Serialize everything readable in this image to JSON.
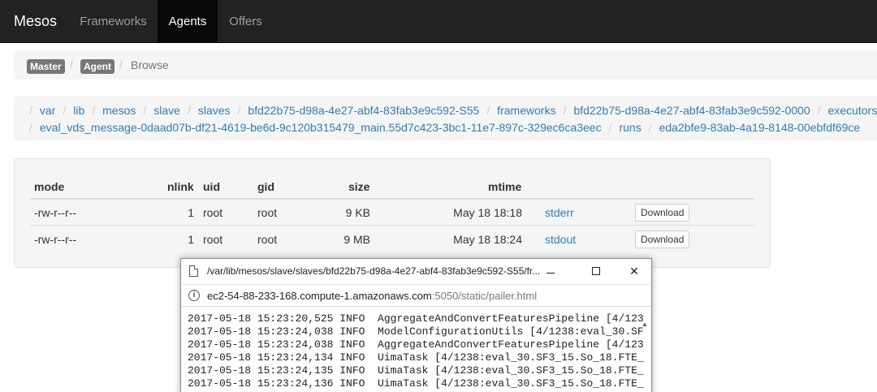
{
  "navbar": {
    "brand": "Mesos",
    "items": [
      "Frameworks",
      "Agents",
      "Offers"
    ],
    "active": "Agents"
  },
  "breadcrumb_top": {
    "items": [
      "Master",
      "Agent",
      "Browse"
    ]
  },
  "path": {
    "line1": [
      "var",
      "lib",
      "mesos",
      "slave",
      "slaves",
      "bfd22b75-d98a-4e27-abf4-83fab3e9c592-S55",
      "frameworks",
      "bfd22b75-d98a-4e27-abf4-83fab3e9c592-0000",
      "executors"
    ],
    "line2": [
      "eval_vds_message-0daad07b-df21-4619-be6d-9c120b315479_main.55d7c423-3bc1-11e7-897c-329ec6ca3eec",
      "runs",
      "eda2bfe9-83ab-4a19-8148-00ebfdf69ce"
    ]
  },
  "files": {
    "columns": [
      "mode",
      "nlink",
      "uid",
      "gid",
      "size",
      "mtime"
    ],
    "rows": [
      {
        "mode": "-rw-r--r--",
        "nlink": "1",
        "uid": "root",
        "gid": "root",
        "size": "9 KB",
        "mtime": "May 18 18:18",
        "name": "stderr",
        "action": "Download"
      },
      {
        "mode": "-rw-r--r--",
        "nlink": "1",
        "uid": "root",
        "gid": "root",
        "size": "9 MB",
        "mtime": "May 18 18:24",
        "name": "stdout",
        "action": "Download"
      }
    ]
  },
  "popup": {
    "title": "/var/lib/mesos/slave/slaves/bfd22b75-d98a-4e27-abf4-83fab3e9c592-S55/fr...",
    "url_host": "ec2-54-88-233-168.compute-1.amazonaws.com",
    "url_rest": ":5050/static/pailer.html",
    "log_lines": [
      "2017-05-18 15:23:20,525 INFO  AggregateAndConvertFeaturesPipeline [4/123",
      "2017-05-18 15:23:24,038 INFO  ModelConfigurationUtils [4/1238:eval_30.SF",
      "2017-05-18 15:23:24,038 INFO  AggregateAndConvertFeaturesPipeline [4/123",
      "2017-05-18 15:23:24,134 INFO  UimaTask [4/1238:eval_30.SF3_15.So_18.FTE_",
      "2017-05-18 15:23:24,135 INFO  UimaTask [4/1238:eval_30.SF3_15.So_18.FTE_",
      "2017-05-18 15:23:24,136 INFO  UimaTask [4/1238:eval_30.SF3_15.So_18.FTE_"
    ]
  }
}
